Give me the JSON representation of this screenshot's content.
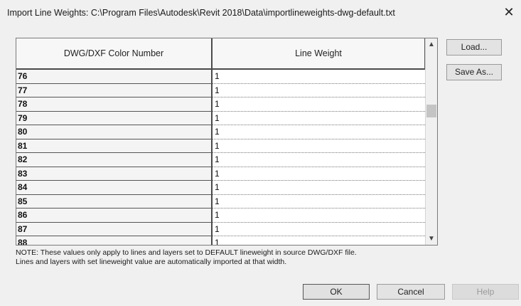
{
  "window": {
    "title": "Import Line Weights: C:\\Program Files\\Autodesk\\Revit 2018\\Data\\importlineweights-dwg-default.txt",
    "close_icon": "✕"
  },
  "grid": {
    "columns": [
      "DWG/DXF Color Number",
      "Line Weight"
    ],
    "rows": [
      {
        "color": "76",
        "weight": "1"
      },
      {
        "color": "77",
        "weight": "1"
      },
      {
        "color": "78",
        "weight": "1"
      },
      {
        "color": "79",
        "weight": "1"
      },
      {
        "color": "80",
        "weight": "1"
      },
      {
        "color": "81",
        "weight": "1"
      },
      {
        "color": "82",
        "weight": "1"
      },
      {
        "color": "83",
        "weight": "1"
      },
      {
        "color": "84",
        "weight": "1"
      },
      {
        "color": "85",
        "weight": "1"
      },
      {
        "color": "86",
        "weight": "1"
      },
      {
        "color": "87",
        "weight": "1"
      },
      {
        "color": "88",
        "weight": "1"
      }
    ],
    "scroll_up_icon": "▲",
    "scroll_down_icon": "▼"
  },
  "side_buttons": {
    "load": "Load...",
    "save_as": "Save As..."
  },
  "note": {
    "line1": "NOTE: These values only apply to lines and layers set to DEFAULT lineweight in source DWG/DXF file.",
    "line2": "Lines and layers with set lineweight value are automatically imported at that width."
  },
  "footer": {
    "ok": "OK",
    "cancel": "Cancel",
    "help": "Help"
  }
}
